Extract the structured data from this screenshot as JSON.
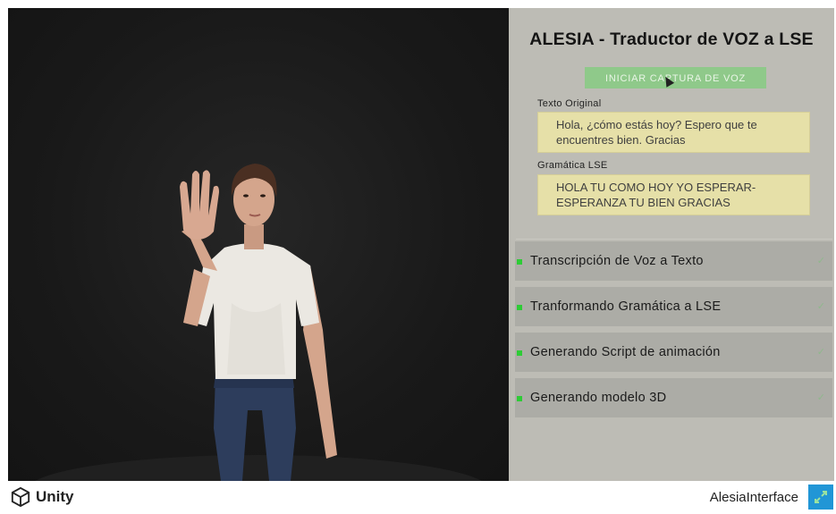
{
  "panel": {
    "title": "ALESIA - Traductor de VOZ a LSE",
    "capture_button": "Iniciar Captura de Voz",
    "original_label": "Texto Original",
    "original_text": "Hola, ¿cómo estás hoy? Espero que te encuentres bien. Gracias",
    "lse_label": "Gramática LSE",
    "lse_text": "HOLA TU COMO HOY YO ESPERAR-ESPERANZA TU BIEN GRACIAS"
  },
  "steps": [
    {
      "label": "Transcripción de Voz a Texto",
      "status": "done"
    },
    {
      "label": "Tranformando Gramática a LSE",
      "status": "done"
    },
    {
      "label": "Generando Script de animación",
      "status": "done"
    },
    {
      "label": "Generando modelo 3D",
      "status": "done"
    }
  ],
  "footer": {
    "brand": "Unity",
    "app_name": "AlesiaInterface"
  },
  "colors": {
    "panel_bg": "#bdbcb5",
    "button_green": "#8fc98a",
    "field_yellow": "#e6e0a8",
    "step_bg": "#acaca6",
    "status_dot": "#2ecc36",
    "expand_blue": "#2196d6"
  }
}
